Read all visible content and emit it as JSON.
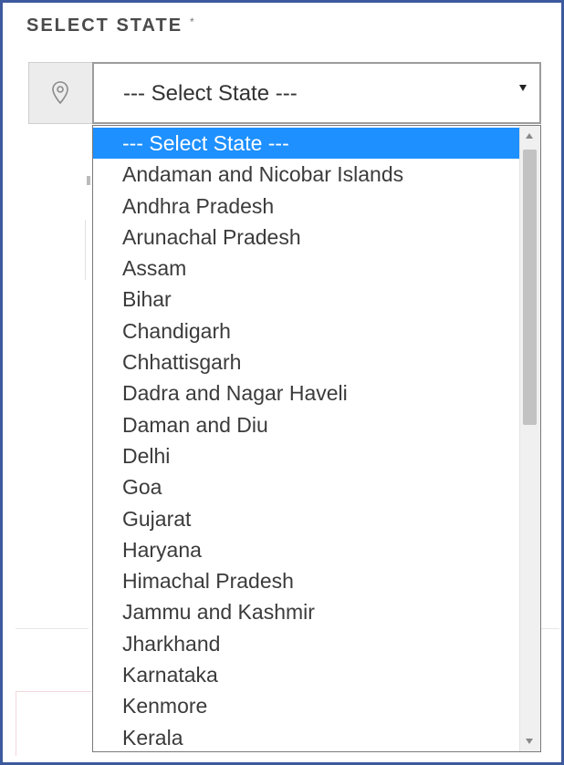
{
  "form": {
    "label": "SELECT STATE",
    "required_mark": "*",
    "select": {
      "value": "--- Select State ---",
      "icon": "map-pin-icon"
    }
  },
  "dropdown": {
    "options": [
      "--- Select State ---",
      "Andaman and Nicobar Islands",
      "Andhra Pradesh",
      "Arunachal Pradesh",
      "Assam",
      "Bihar",
      "Chandigarh",
      "Chhattisgarh",
      "Dadra and Nagar Haveli",
      "Daman and Diu",
      "Delhi",
      "Goa",
      "Gujarat",
      "Haryana",
      "Himachal Pradesh",
      "Jammu and Kashmir",
      "Jharkhand",
      "Karnataka",
      "Kenmore",
      "Kerala"
    ],
    "highlighted_index": 0
  },
  "colors": {
    "frame": "#3e5a9e",
    "highlight": "#1e90ff"
  }
}
